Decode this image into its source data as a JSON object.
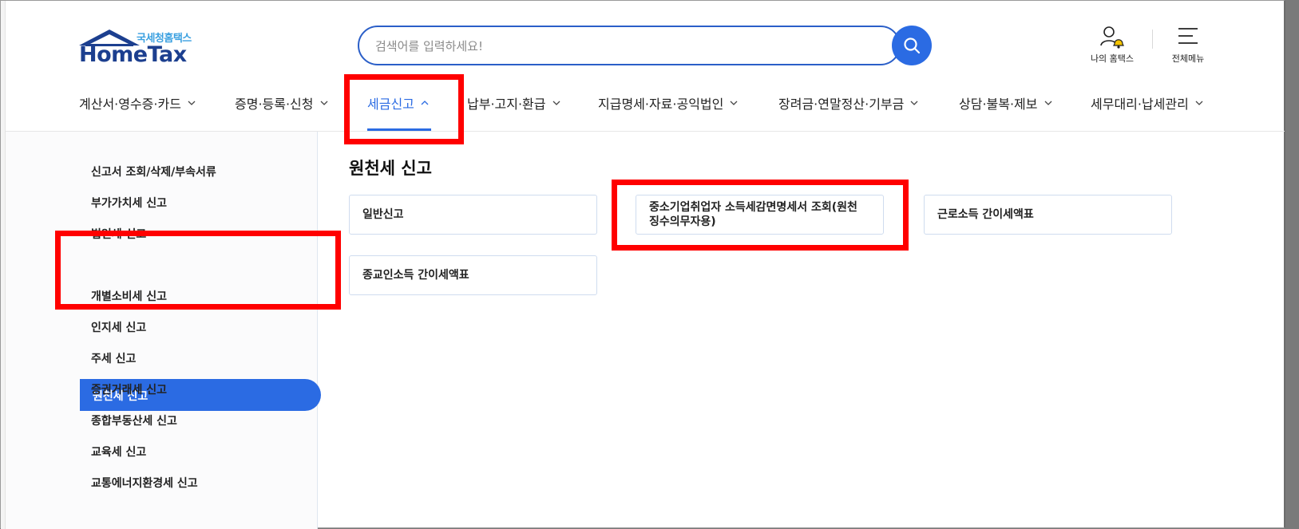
{
  "logo": {
    "sub": "국세청홈택스",
    "main": "HomeTax"
  },
  "search": {
    "placeholder": "검색어를 입력하세요!"
  },
  "header_links": {
    "my_hometax": "나의 홈택스",
    "all_menu": "전체메뉴"
  },
  "nav": {
    "items": [
      {
        "label": "계산서·영수증·카드"
      },
      {
        "label": "증명·등록·신청"
      },
      {
        "label": "세금신고"
      },
      {
        "label": "납부·고지·환급"
      },
      {
        "label": "지급명세·자료·공익법인"
      },
      {
        "label": "장려금·연말정산·기부금"
      },
      {
        "label": "상담·불복·제보"
      },
      {
        "label": "세무대리·납세관리"
      }
    ],
    "active_index": 2
  },
  "sidebar": {
    "items": [
      {
        "label": "신고서 조회/삭제/부속서류"
      },
      {
        "label": "부가가치세 신고"
      },
      {
        "label": "법인세 신고"
      },
      {
        "label": "원천세 신고"
      },
      {
        "label": "개별소비세 신고"
      },
      {
        "label": "인지세 신고"
      },
      {
        "label": "주세 신고"
      },
      {
        "label": "증권거래세 신고"
      },
      {
        "label": "종합부동산세 신고"
      },
      {
        "label": "교육세 신고"
      },
      {
        "label": "교통에너지환경세 신고"
      }
    ],
    "active_index": 3
  },
  "content": {
    "title": "원천세 신고",
    "cards": [
      {
        "label": "일반신고"
      },
      {
        "label": "중소기업취업자 소득세감면명세서 조회(원천징수의무자용)"
      },
      {
        "label": "근로소득 간이세액표"
      },
      {
        "label": "종교인소득 간이세액표"
      }
    ]
  },
  "colors": {
    "accent": "#2b6be3",
    "brand_dark": "#1c3f8f",
    "highlight": "#ff0000"
  }
}
